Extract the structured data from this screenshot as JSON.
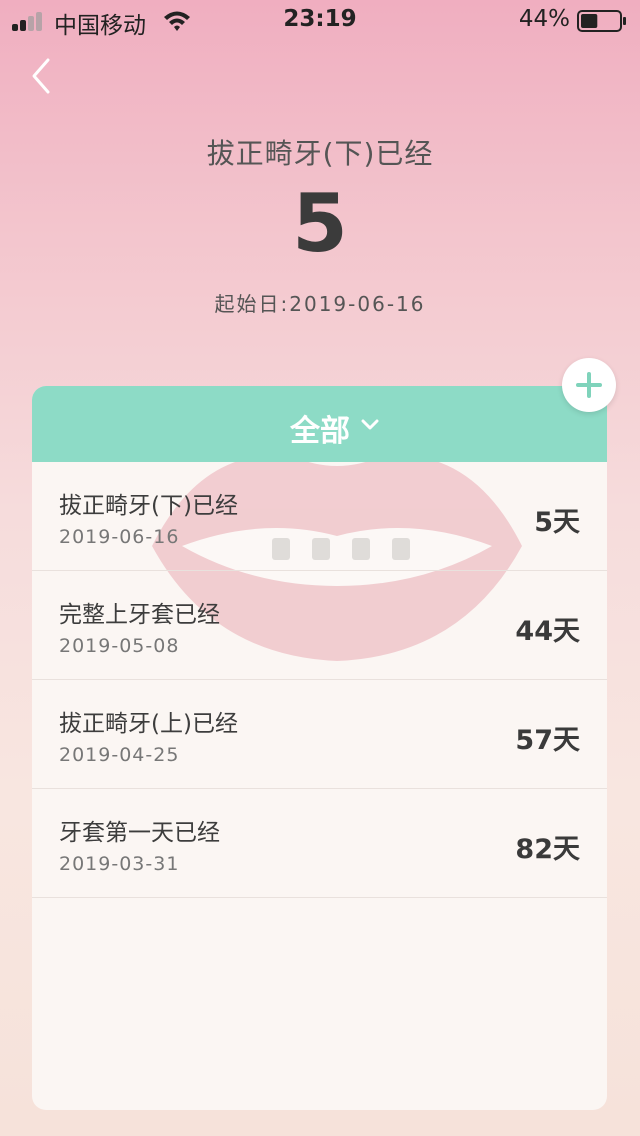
{
  "status_bar": {
    "carrier": "中国移动",
    "time": "23:19",
    "battery_percent": "44%",
    "battery_level": 0.44,
    "signal_bars": 2
  },
  "header": {
    "title": "拔正畸牙(下)已经",
    "count": "5",
    "start_label": "起始日:",
    "start_date": "2019-06-16"
  },
  "filter": {
    "label": "全部"
  },
  "items": [
    {
      "name": "拔正畸牙(下)已经",
      "date": "2019-06-16",
      "days": "5天"
    },
    {
      "name": "完整上牙套已经",
      "date": "2019-05-08",
      "days": "44天"
    },
    {
      "name": "拔正畸牙(上)已经",
      "date": "2019-04-25",
      "days": "57天"
    },
    {
      "name": "牙套第一天已经",
      "date": "2019-03-31",
      "days": "82天"
    }
  ],
  "colors": {
    "accent": "#8ddbc6",
    "card": "#fbf6f3",
    "text_dark": "#3b3b3b"
  },
  "icons": {
    "back": "chevron-left-icon",
    "add": "plus-icon",
    "dropdown": "chevron-down-icon",
    "wifi": "wifi-icon",
    "battery": "battery-icon",
    "signal": "signal-icon"
  }
}
